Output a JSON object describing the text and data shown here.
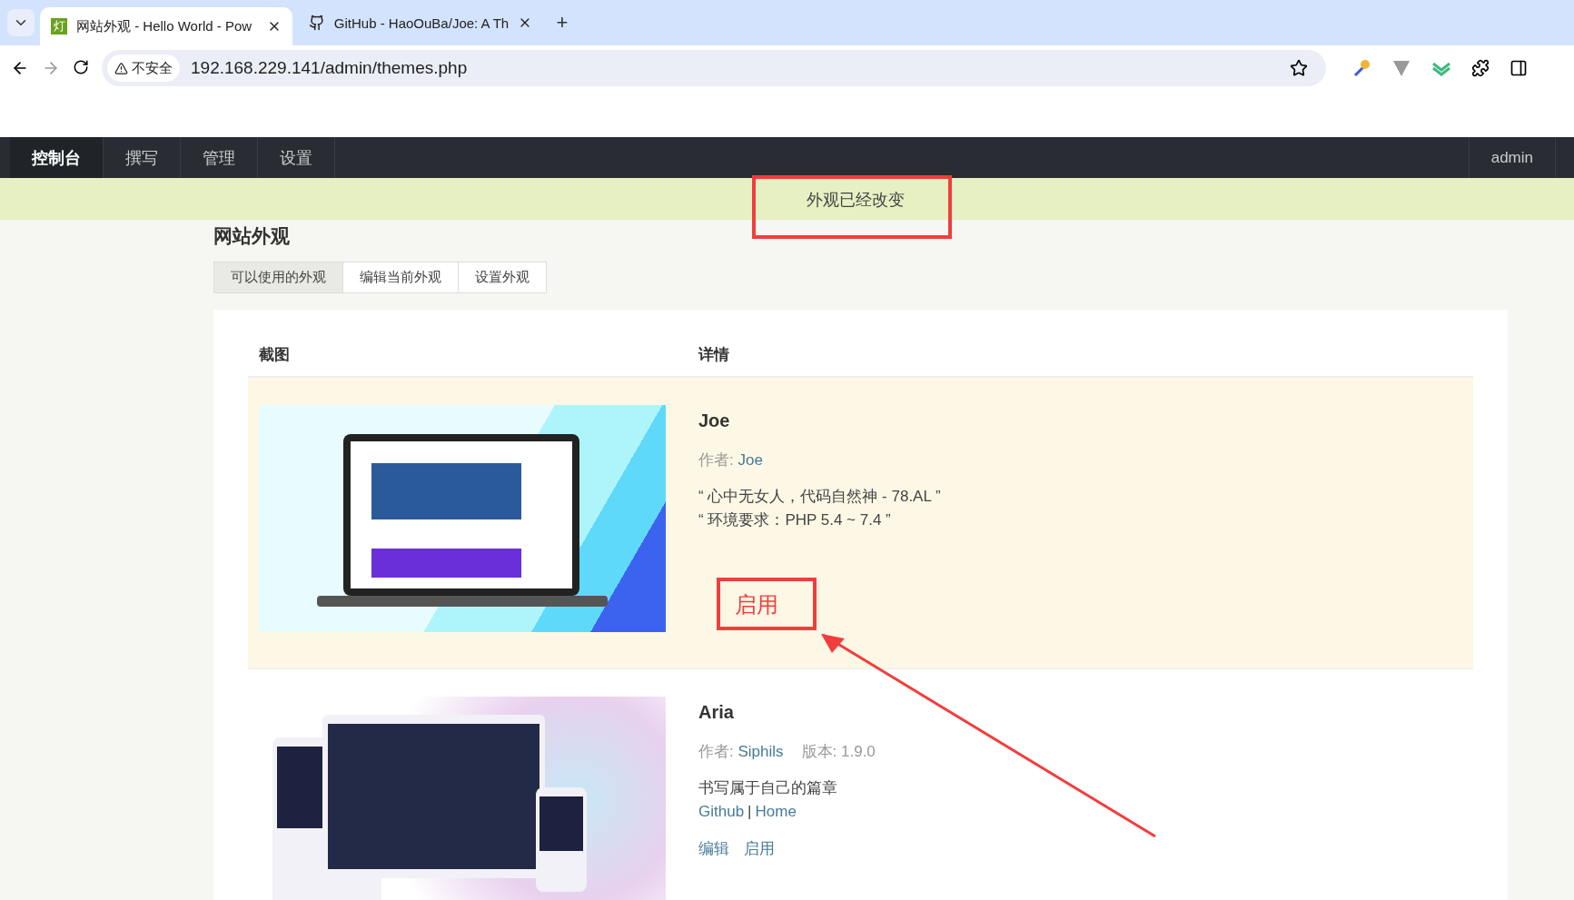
{
  "browser": {
    "tabs": [
      {
        "title": "网站外观 - Hello World - Pow",
        "favicon_text": "灯",
        "selected": true
      },
      {
        "title": "GitHub - HaoOuBa/Joe: A Th",
        "selected": false
      }
    ],
    "new_tab": "+",
    "security": "不安全",
    "url": "192.168.229.141/admin/themes.php"
  },
  "nav": {
    "items": [
      {
        "label": "控制台",
        "selected": true
      },
      {
        "label": "撰写",
        "selected": false
      },
      {
        "label": "管理",
        "selected": false
      },
      {
        "label": "设置",
        "selected": false
      }
    ],
    "user": "admin"
  },
  "notice": {
    "text": "外观已经改变",
    "highlighted": true
  },
  "page_title": "网站外观",
  "tabs": [
    {
      "label": "可以使用的外观",
      "selected": true
    },
    {
      "label": "编辑当前外观",
      "selected": false
    },
    {
      "label": "设置外观",
      "selected": false
    }
  ],
  "table": {
    "columns": [
      "截图",
      "详情"
    ],
    "rows": [
      {
        "name": "Joe",
        "author_label": "作者:",
        "author": "Joe",
        "selected": true,
        "kind": "laptop",
        "description": [
          "“ 心中无女人，代码自然神 - 78.AL ”",
          "“ 环境要求：PHP 5.4 ~ 7.4 ”"
        ],
        "actions": [
          {
            "label": "启用",
            "highlighted": true
          }
        ]
      },
      {
        "name": "Aria",
        "author_label": "作者:",
        "author": "Siphils",
        "version": "版本: 1.9.0",
        "selected": false,
        "kind": "devices",
        "description": [
          "书写属于自己的篇章"
        ],
        "links": [
          "Github",
          "Home"
        ],
        "link_separator": "|",
        "actions": [
          {
            "label": "编辑",
            "highlighted": false
          },
          {
            "label": "启用",
            "highlighted": false
          }
        ]
      }
    ]
  }
}
